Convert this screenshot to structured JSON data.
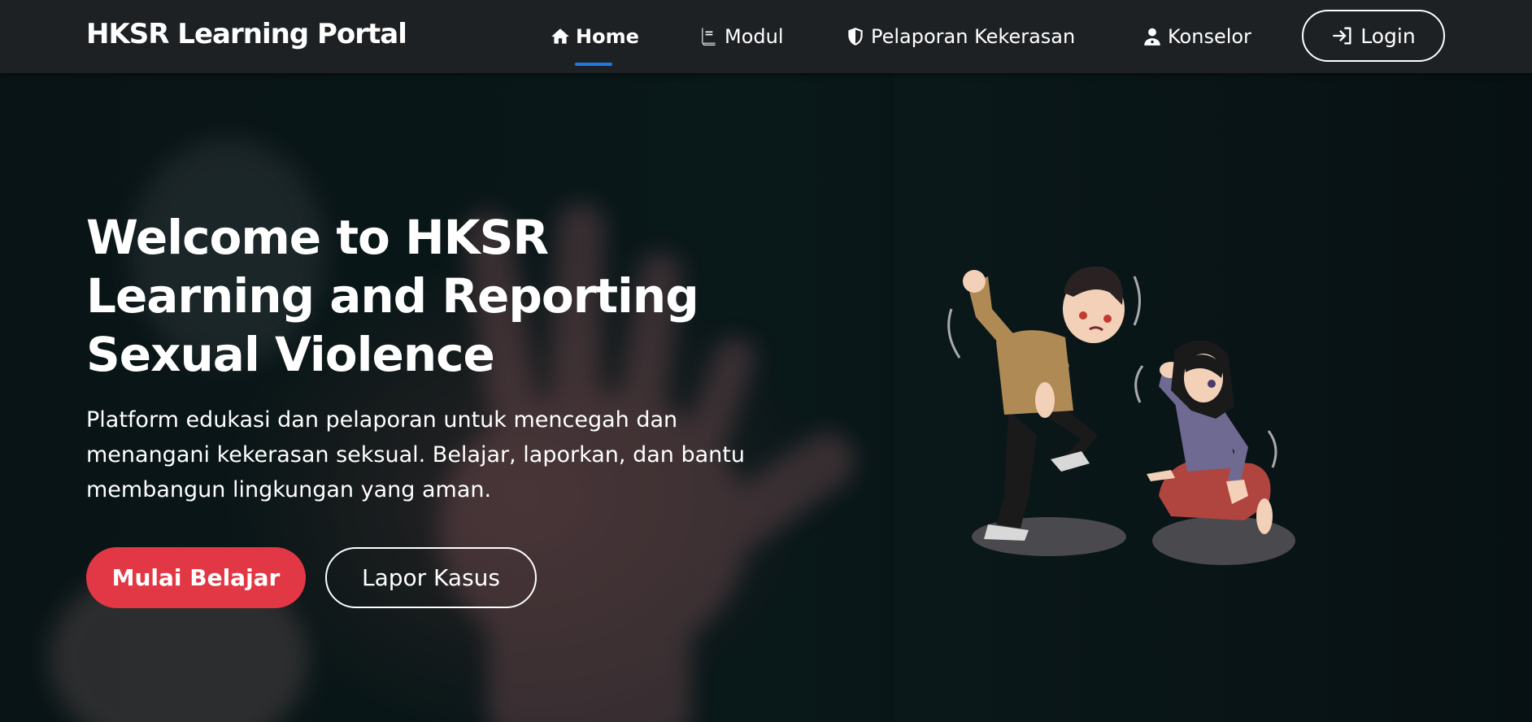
{
  "navbar": {
    "brand": "HKSR Learning Portal",
    "items": [
      {
        "label": "Home",
        "icon": "home-icon",
        "active": true
      },
      {
        "label": "Modul",
        "icon": "book-icon",
        "active": false
      },
      {
        "label": "Pelaporan Kekerasan",
        "icon": "shield-icon",
        "active": false
      },
      {
        "label": "Konselor",
        "icon": "doctor-icon",
        "active": false
      }
    ],
    "login_label": "Login",
    "active_color": "#1e78e6"
  },
  "hero": {
    "title": "Welcome to HKSR Learning and Reporting Sexual Violence",
    "description": "Platform edukasi dan pelaporan untuk mencegah dan menangani kekerasan seksual. Belajar, laporkan, dan bantu membangun lingkungan yang aman.",
    "primary_button": "Mulai Belajar",
    "secondary_button": "Lapor Kasus",
    "primary_color": "#e23744"
  }
}
